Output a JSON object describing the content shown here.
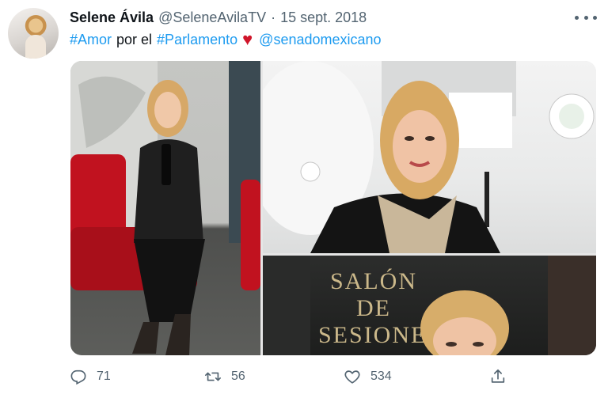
{
  "tweet": {
    "author_name": "Selene Ávila",
    "handle": "@SeleneAvilaTV",
    "separator": "·",
    "date": "15 sept. 2018",
    "text": {
      "hashtag_1": "#Amor",
      "word": "por el",
      "hashtag_2": "#Parlamento",
      "emoji": "♥",
      "mention": "@senadomexicano"
    },
    "photo_sign_text": "SALÓN DE SESIONES",
    "actions": {
      "reply_count": "71",
      "retweet_count": "56",
      "like_count": "534"
    }
  },
  "icons": {
    "more": "more-options-icon",
    "reply": "reply-icon",
    "retweet": "retweet-icon",
    "like": "heart-icon",
    "share": "share-icon"
  },
  "colors": {
    "link": "#1d9bf0",
    "muted": "#536471",
    "heart": "#d0152a"
  }
}
